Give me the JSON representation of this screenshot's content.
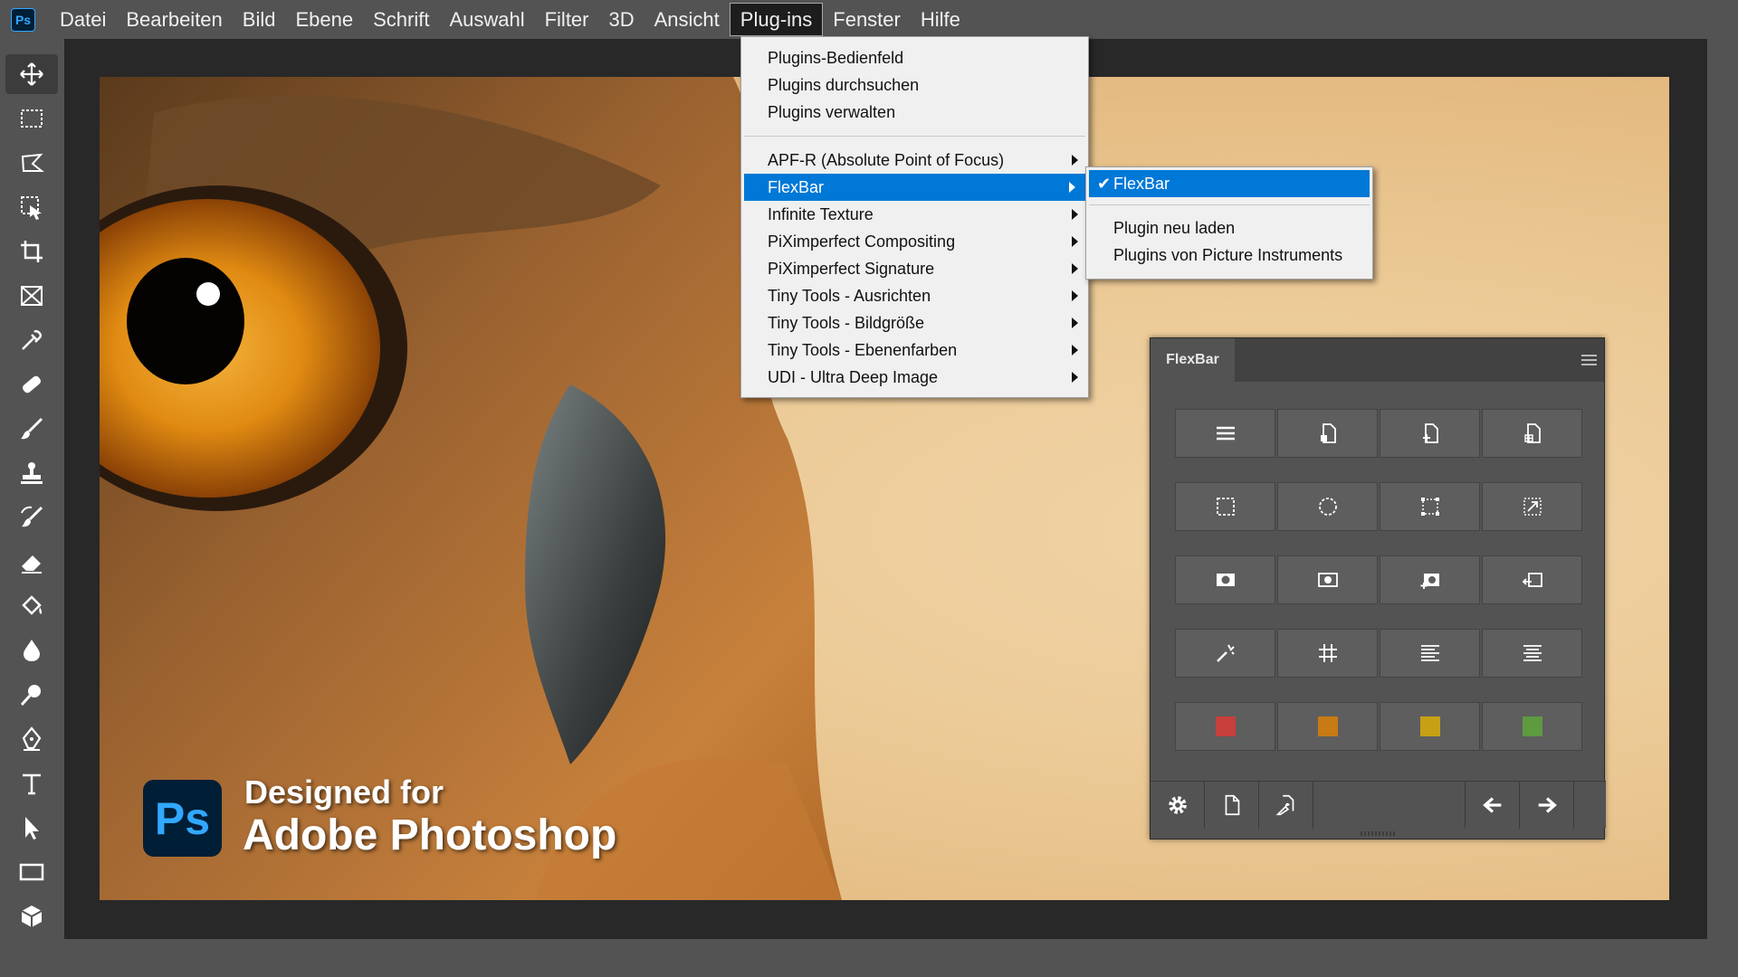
{
  "app": {
    "logo": "Ps"
  },
  "menubar": [
    {
      "label": "Datei"
    },
    {
      "label": "Bearbeiten"
    },
    {
      "label": "Bild"
    },
    {
      "label": "Ebene"
    },
    {
      "label": "Schrift"
    },
    {
      "label": "Auswahl"
    },
    {
      "label": "Filter"
    },
    {
      "label": "3D"
    },
    {
      "label": "Ansicht"
    },
    {
      "label": "Plug-ins",
      "active": true
    },
    {
      "label": "Fenster"
    },
    {
      "label": "Hilfe"
    }
  ],
  "plugins_menu": {
    "group1": [
      "Plugins-Bedienfeld",
      "Plugins durchsuchen",
      "Plugins verwalten"
    ],
    "group2": [
      "APF-R (Absolute Point of Focus)",
      "FlexBar",
      "Infinite Texture",
      "PiXimperfect Compositing",
      "PiXimperfect Signature",
      "Tiny Tools - Ausrichten",
      "Tiny Tools - Bildgröße",
      "Tiny Tools - Ebenenfarben",
      "UDI - Ultra Deep Image"
    ],
    "highlighted": "FlexBar"
  },
  "submenu": {
    "checked": "FlexBar",
    "items": [
      "Plugin neu laden",
      "Plugins von Picture Instruments"
    ]
  },
  "badge": {
    "logo": "Ps",
    "line1": "Designed for",
    "line2": "Adobe Photoshop"
  },
  "flexbar": {
    "title": "FlexBar",
    "color_swatches": [
      "#c8403c",
      "#c87a14",
      "#c8a014",
      "#5e9a40"
    ]
  },
  "tools": [
    "move-icon",
    "marquee-icon",
    "lasso-icon",
    "object-select-icon",
    "crop-icon",
    "frame-icon",
    "eyedropper-icon",
    "healing-icon",
    "brush-icon",
    "stamp-icon",
    "history-brush-icon",
    "eraser-icon",
    "paint-bucket-icon",
    "blur-icon",
    "dodge-icon",
    "pen-icon",
    "type-icon",
    "path-select-icon",
    "rectangle-icon",
    "3d-icon"
  ]
}
